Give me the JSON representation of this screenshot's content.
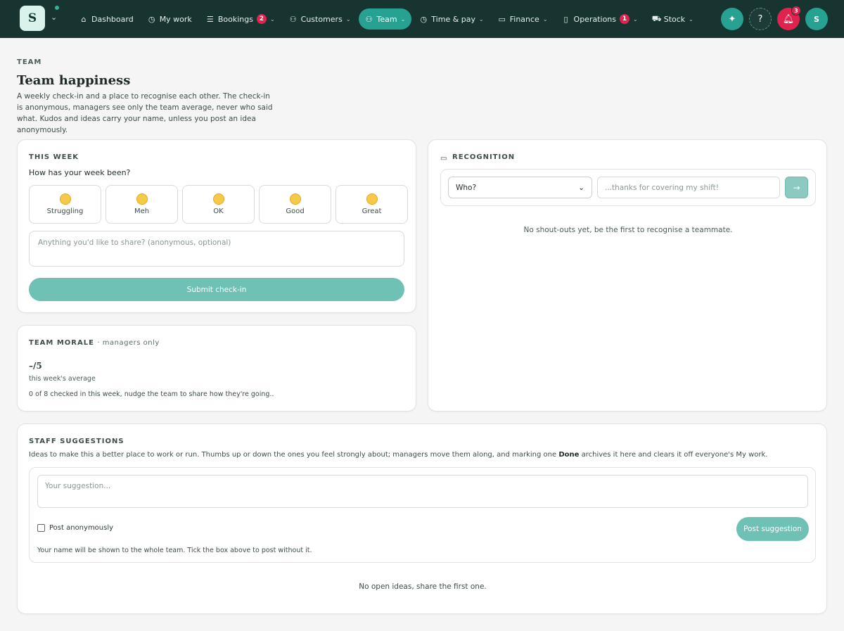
{
  "brand": {
    "logo_letter": "S"
  },
  "nav": {
    "items": [
      {
        "icon": "⌂",
        "label": "Dashboard",
        "badge": "",
        "caret": ""
      },
      {
        "icon": "◷",
        "label": "My work",
        "badge": "",
        "caret": ""
      },
      {
        "icon": "☰",
        "label": "Bookings",
        "badge": "2",
        "caret": "⌄"
      },
      {
        "icon": "⚇",
        "label": "Customers",
        "badge": "",
        "caret": "⌄"
      },
      {
        "icon": "⚇",
        "label": "Team",
        "badge": "",
        "caret": "⌄",
        "active": true
      },
      {
        "icon": "◷",
        "label": "Time & pay",
        "badge": "",
        "caret": "⌄"
      },
      {
        "icon": "▭",
        "label": "Finance",
        "badge": "",
        "caret": "⌄"
      },
      {
        "icon": "▯",
        "label": "Operations",
        "badge": "1",
        "caret": "⌄"
      },
      {
        "icon": "⛟",
        "label": "Stock",
        "badge": "",
        "caret": "⌄"
      }
    ],
    "notifications_count": "3",
    "avatar_initial": "S"
  },
  "header": {
    "eyebrow": "TEAM",
    "title": "Team happiness",
    "description": "A weekly check-in and a place to recognise each other. The check-in is anonymous, managers see only the team average, never who said what. Kudos and ideas carry your name, unless you post an idea anonymously."
  },
  "checkin": {
    "title": "THIS WEEK",
    "question": "How has your week been?",
    "moods": [
      {
        "face": "˘︵˘",
        "label": "Struggling"
      },
      {
        "face": "•_•",
        "label": "Meh"
      },
      {
        "face": "•–•",
        "label": "OK"
      },
      {
        "face": "•‿•",
        "label": "Good"
      },
      {
        "face": "^▽^",
        "label": "Great"
      }
    ],
    "share_placeholder": "Anything you'd like to share? (anonymous, optional)",
    "submit_label": "Submit check-in"
  },
  "morale": {
    "title": "TEAM MORALE",
    "subtitle": "· managers only",
    "score": "–/5",
    "score_label": "this week's average",
    "note": "0 of 8 checked in this week, nudge the team to share how they're going.."
  },
  "recognition": {
    "title": "RECOGNITION",
    "who_value": "Who?",
    "thanks_placeholder": "...thanks for covering my shift!",
    "empty": "No shout-outs yet, be the first to recognise a teammate."
  },
  "suggestions": {
    "title": "STAFF SUGGESTIONS",
    "desc_before": "Ideas to make this a better place to work or run. Thumbs up or down the ones you feel strongly about; managers move them along, and marking one ",
    "desc_bold": "Done",
    "desc_after": " archives it here and clears it off everyone's My work.",
    "input_placeholder": "Your suggestion...",
    "anon_label": "Post anonymously",
    "post_label": "Post suggestion",
    "name_note": "Your name will be shown to the whole team. Tick the box above to post without it.",
    "empty": "No open ideas, share the first one."
  }
}
